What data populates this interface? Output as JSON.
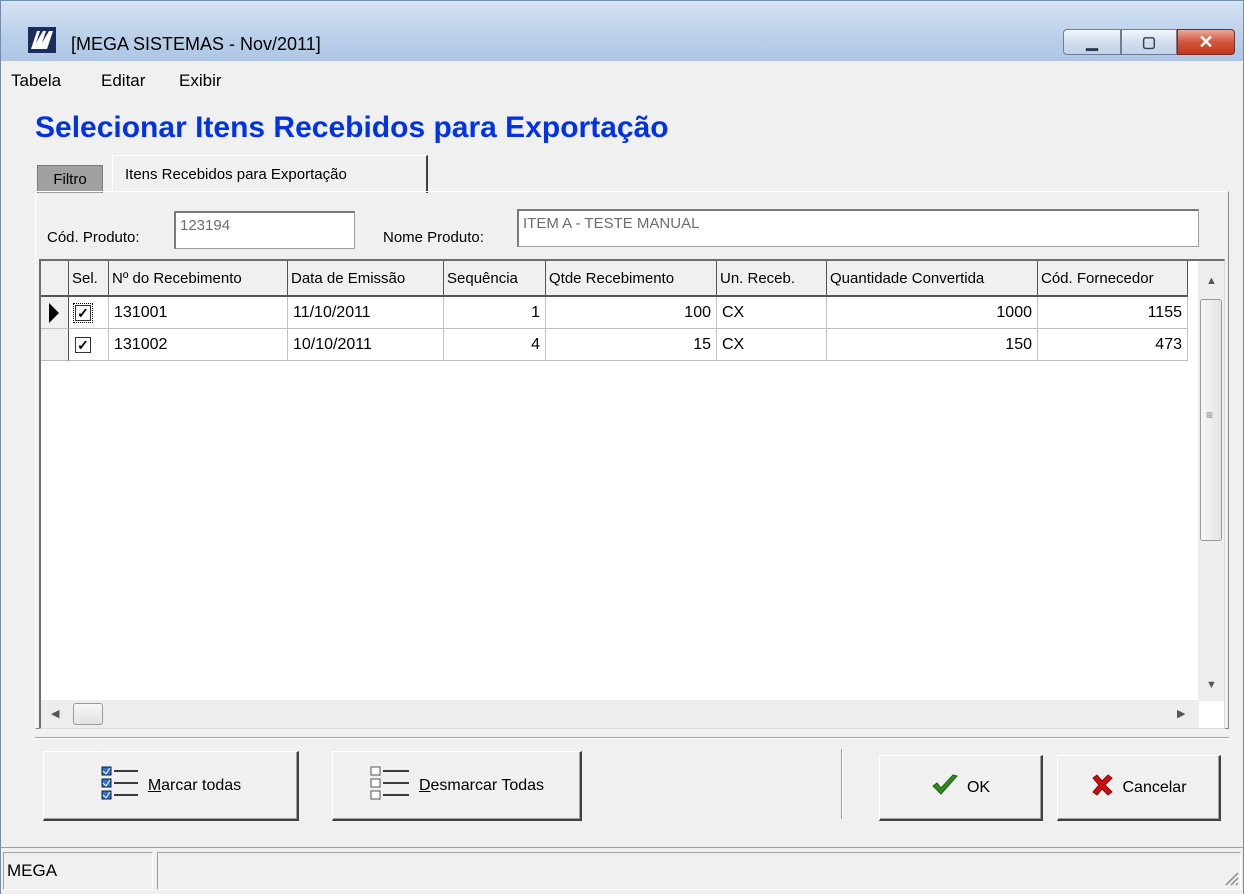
{
  "window": {
    "title": "[MEGA SISTEMAS - Nov/2011]",
    "controls": {
      "minimize": "▁",
      "maximize": "▢",
      "close": "✕"
    }
  },
  "menu": [
    "Tabela",
    "Editar",
    "Exibir"
  ],
  "heading": "Selecionar Itens Recebidos para Exportação",
  "tabs": {
    "filtro": "Filtro",
    "itens": "Itens Recebidos para Exportação"
  },
  "filters": {
    "cod_produto_label": "Cód. Produto:",
    "cod_produto_value": "123194",
    "nome_produto_label": "Nome Produto:",
    "nome_produto_value": "ITEM A - TESTE MANUAL"
  },
  "grid": {
    "columns": [
      "Sel.",
      "Nº do Recebimento",
      "Data de Emissão",
      "Sequência",
      "Qtde Recebimento",
      "Un. Receb.",
      "Quantidade Convertida",
      "Cód. Fornecedor"
    ],
    "rows": [
      {
        "sel": true,
        "recebimento": "131001",
        "data": "11/10/2011",
        "sequencia": "1",
        "qtde": "100",
        "un": "CX",
        "convertida": "1000",
        "fornecedor": "1155",
        "current": true
      },
      {
        "sel": true,
        "recebimento": "131002",
        "data": "10/10/2011",
        "sequencia": "4",
        "qtde": "15",
        "un": "CX",
        "convertida": "150",
        "fornecedor": "473",
        "current": false
      }
    ]
  },
  "buttons": {
    "marcar_prefix": "M",
    "marcar_rest": "arcar todas",
    "desmarcar_prefix": "D",
    "desmarcar_rest": "esmarcar Todas",
    "ok": "OK",
    "cancelar": "Cancelar"
  },
  "status": {
    "left": "MEGA"
  },
  "colors": {
    "heading": "#0032e6",
    "ok_check": "#2e8b1e",
    "cancel_x": "#cc1010"
  }
}
